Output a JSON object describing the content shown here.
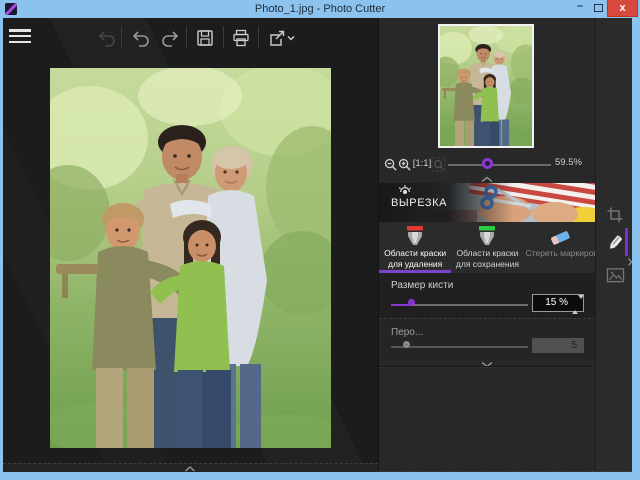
{
  "titlebar": {
    "title": "Photo_1.jpg - Photo Cutter",
    "minimize_glyph": "–",
    "close_glyph": "x"
  },
  "toolbar": {
    "icon_names": [
      "hamburger-menu-icon",
      "undo-disabled-icon",
      "undo-icon",
      "redo-icon",
      "save-icon",
      "print-icon",
      "share-icon"
    ]
  },
  "navigator": {
    "zoom_level": "59.5%",
    "actual_size_glyph": "[1:1]",
    "zoom_slider_percent": 38,
    "icon_names": [
      "zoom-out-icon",
      "zoom-in-icon",
      "actual-size-icon",
      "zoom-fit-icon"
    ]
  },
  "cutout_panel": {
    "header": "ВЫРЕЗКА",
    "tabs": [
      {
        "label": "Области краски для удаления",
        "icon": "red-marker-icon",
        "active": true
      },
      {
        "label": "Области краски для сохранения",
        "icon": "green-marker-icon",
        "active": false
      },
      {
        "label": "Стереть маркировку",
        "icon": "eraser-icon",
        "active": false
      }
    ],
    "brush_size": {
      "label": "Размер кисти",
      "value": "15 %",
      "slider_percent": 17
    },
    "feather": {
      "label": "Перо...",
      "value": "5",
      "slider_percent": 11,
      "disabled": true
    }
  },
  "tool_strip": {
    "icon_names": [
      "crop-icon",
      "pen-tool-icon",
      "image-adjust-icon"
    ],
    "active_tool": "pen-tool-icon"
  },
  "colors": {
    "titlebar_blue": "#8cc2ee",
    "accent_purple": "#8a36d4",
    "tab_underline_purple": "#7c43cf",
    "close_red": "#d8493d",
    "marker_red": "#e23a2e",
    "marker_green": "#2ecc40",
    "eraser_blue": "#6fb3e8"
  }
}
